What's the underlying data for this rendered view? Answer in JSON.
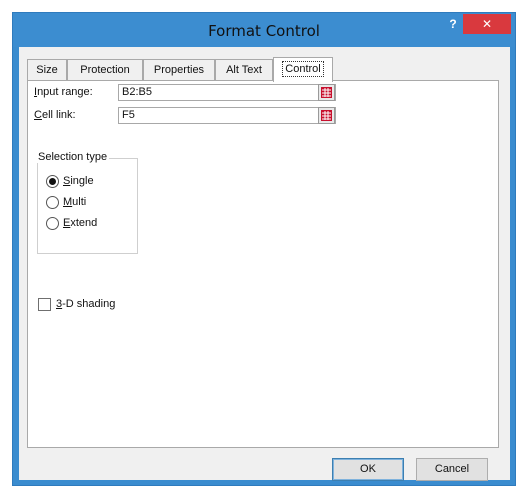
{
  "window": {
    "title": "Format Control",
    "help_glyph": "?",
    "close_glyph": "✕"
  },
  "tabs": [
    {
      "label": "Size"
    },
    {
      "label": "Protection"
    },
    {
      "label": "Properties"
    },
    {
      "label": "Alt Text"
    },
    {
      "label": "Control",
      "active": true
    }
  ],
  "control": {
    "input_range": {
      "label_prefix": "I",
      "label_rest": "nput range:",
      "value": "B2:B5"
    },
    "cell_link": {
      "label_prefix": "C",
      "label_rest": "ell link:",
      "value": "F5"
    },
    "selection_type": {
      "title": "Selection type",
      "options": [
        {
          "prefix": "S",
          "rest": "ingle",
          "checked": true
        },
        {
          "prefix": "M",
          "rest": "ulti",
          "checked": false
        },
        {
          "prefix": "E",
          "rest": "xtend",
          "checked": false
        }
      ]
    },
    "shading": {
      "prefix": "3",
      "rest": "-D shading",
      "checked": false
    }
  },
  "buttons": {
    "ok": "OK",
    "cancel": "Cancel"
  },
  "colors": {
    "titlebar": "#3c8dd0",
    "close": "#d9393e",
    "ref_icon": "#c8102e"
  },
  "icons": {
    "ref_button": "collapse-dialog-icon"
  }
}
